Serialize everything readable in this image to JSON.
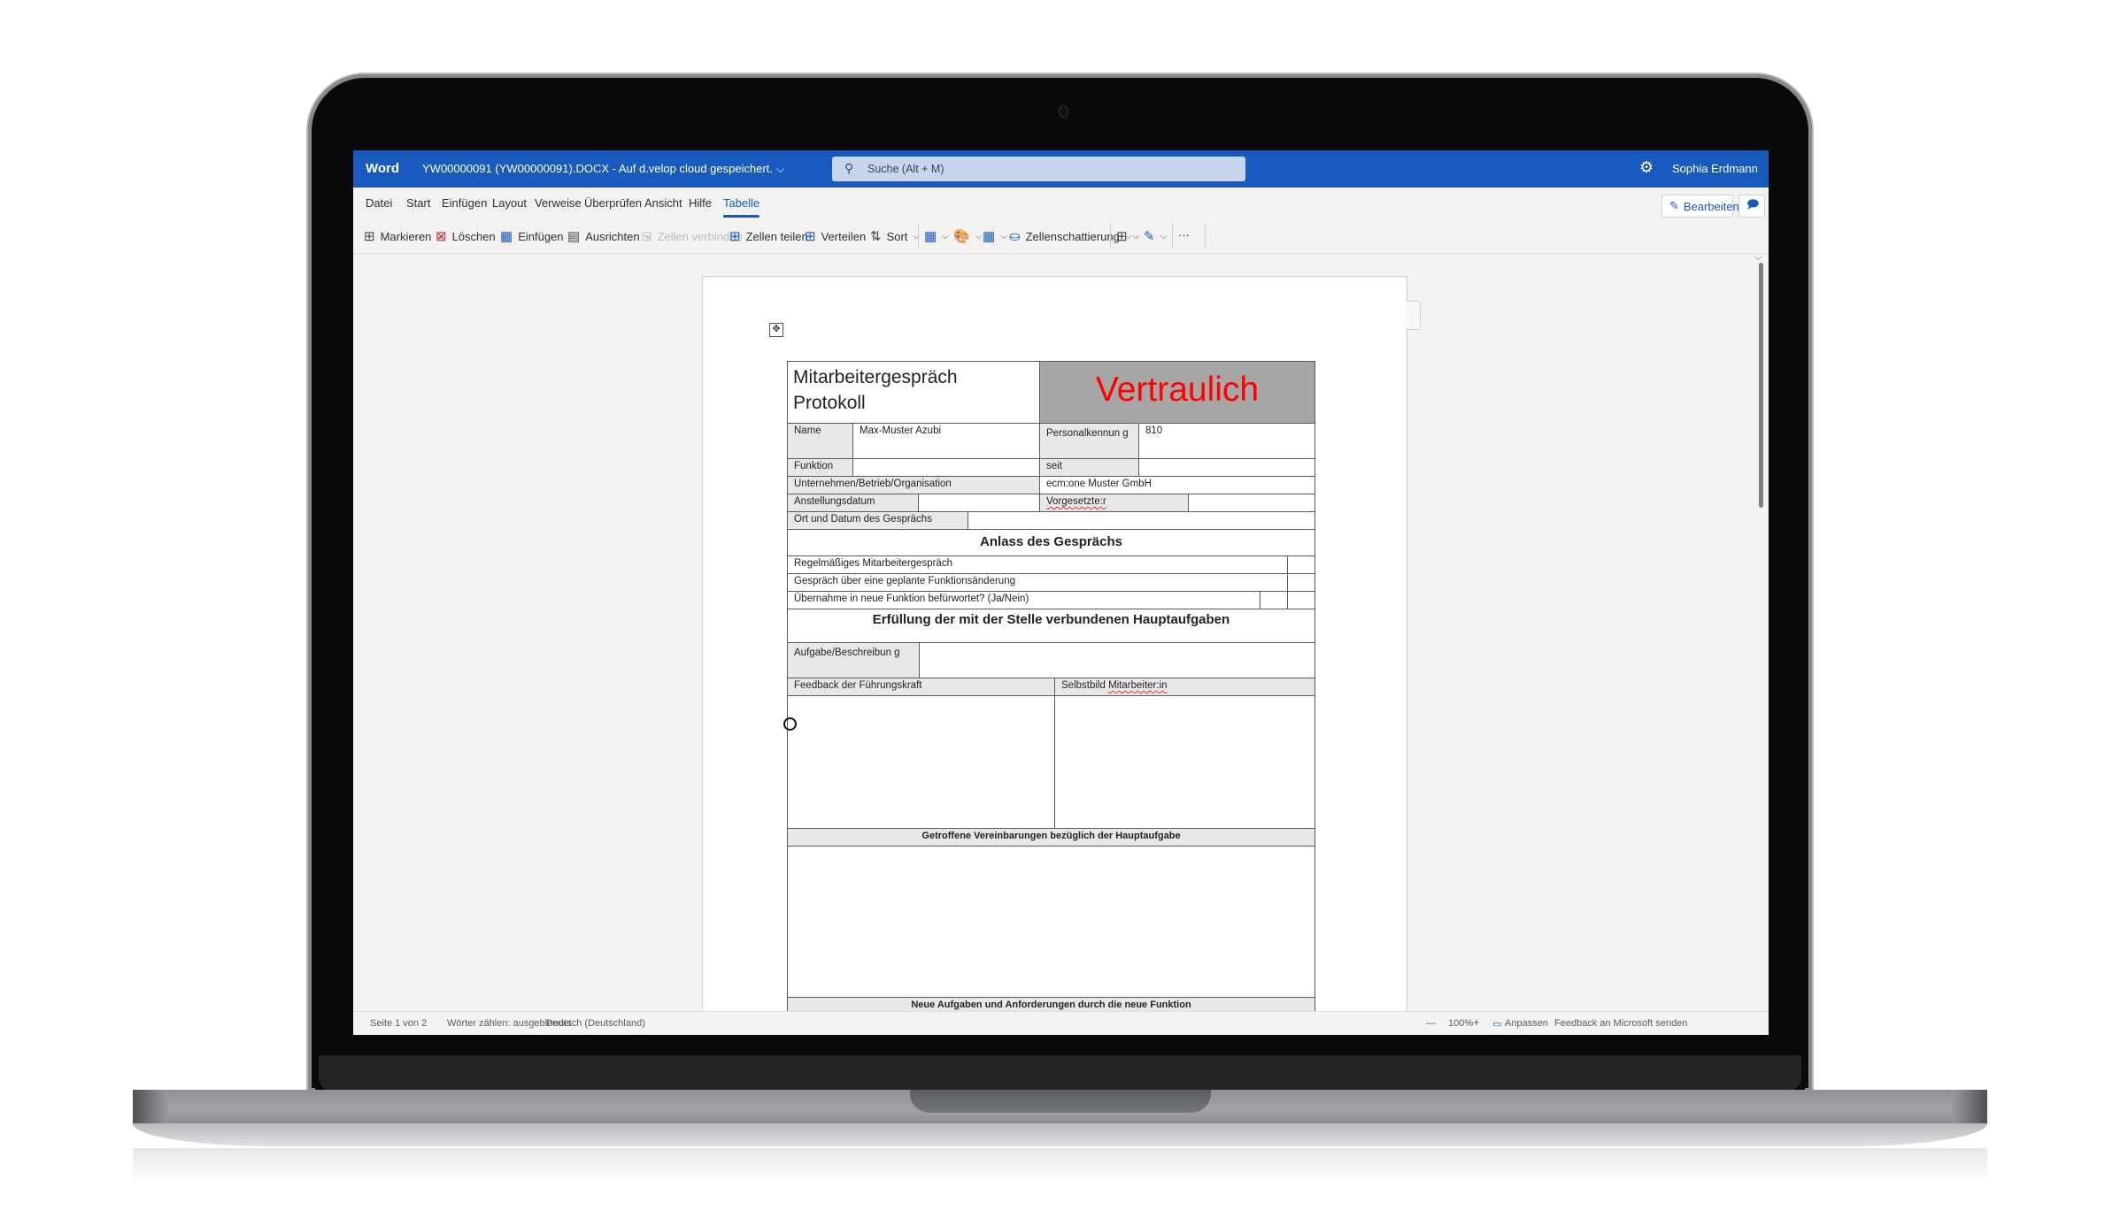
{
  "titlebar": {
    "app_name": "Word",
    "document_title": "YW00000091 (YW00000091).DOCX  -  Auf d.velop cloud gespeichert. ⌵",
    "search_placeholder": "Suche (Alt + M)",
    "settings_icon": "⚙",
    "user_name": "Sophia Erdmann"
  },
  "menu": {
    "items": [
      "Datei",
      "Start",
      "Einfügen",
      "Layout",
      "Verweise",
      "Überprüfen",
      "Ansicht",
      "Hilfe",
      "Tabelle"
    ],
    "active": "Tabelle",
    "edit_button": "Bearbeiten",
    "comments_button": "Kommentare"
  },
  "ribbon": {
    "markieren": "Markieren",
    "loeschen": "Löschen",
    "einfuegen": "Einfügen",
    "ausrichten": "Ausrichten",
    "zellen_verbinden": "Zellen verbinden",
    "zellen_teilen": "Zellen teilen",
    "verteilen": "Verteilen",
    "sort": "Sort",
    "zellenschattierung": "Zellenschattierung",
    "more": "···"
  },
  "document": {
    "title_line1": "Mitarbeitergespräch",
    "title_line2": "Protokoll",
    "confidential": "Vertraulich",
    "confidential_color": "#ff0000",
    "fields": {
      "name_label": "Name",
      "name_value": "Max-Muster Azubi",
      "personalkennung_label": "Personalkennun g",
      "personalkennung_value": "810",
      "funktion_label": "Funktion",
      "funktion_value": "",
      "seit_label": "seit",
      "seit_value": "",
      "unternehmen_label": "Unternehmen/Betrieb/Organisation",
      "unternehmen_value": "ecm:one Muster GmbH",
      "anstellungsdatum_label": "Anstellungsdatum",
      "anstellungsdatum_value": "",
      "vorgesetzte_label": "Vorgesetzte:r",
      "vorgesetzte_value": "",
      "ort_datum_label": "Ort und Datum des Gesprächs",
      "ort_datum_value": ""
    },
    "section_anlass": "Anlass des Gesprächs",
    "anlass_items": [
      "Regelmäßiges Mitarbeitergespräch",
      "Gespräch über eine geplante Funktionsänderung",
      "Übernahme in neue Funktion befürwortet? (Ja/Nein)"
    ],
    "section_erfuellung": "Erfüllung der mit der Stelle verbundenen Hauptaufgaben",
    "aufgabe_label": "Aufgabe/Beschreibun g",
    "feedback_label": "Feedback der Führungskraft",
    "selbstbild_label_prefix": "Selbstbild ",
    "selbstbild_label_word": "Mitarbeiter:in",
    "vereinbarungen_label": "Getroffene Vereinbarungen bezüglich der Hauptaufgabe",
    "neue_aufgaben_label": "Neue Aufgaben und Anforderungen durch die neue Funktion"
  },
  "statusbar": {
    "page": "Seite 1 von 2",
    "words": "Wörter zählen: ausgeblendet",
    "language": "Deutsch (Deutschland)",
    "zoom_out": "—",
    "zoom_level": "100%",
    "zoom_in": "+",
    "fit": "Anpassen",
    "feedback": "Feedback an Microsoft senden"
  }
}
